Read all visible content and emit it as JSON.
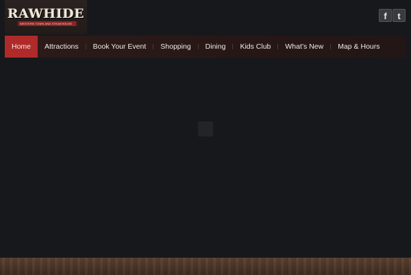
{
  "brand": {
    "name": "RAWHIDE",
    "tagline": "WESTERN TOWN AND STEAKHOUSE"
  },
  "social": {
    "facebook_label": "f",
    "twitter_label": "t"
  },
  "nav": {
    "items": [
      {
        "label": "Home",
        "active": true
      },
      {
        "label": "Attractions"
      },
      {
        "label": "Book Your Event"
      },
      {
        "label": "Shopping"
      },
      {
        "label": "Dining"
      },
      {
        "label": "Kids Club"
      },
      {
        "label": "What’s New"
      },
      {
        "label": "Map & Hours"
      }
    ]
  },
  "colors": {
    "background": "#17181c",
    "nav_bar": "#261716",
    "active_item": "#b02a2a",
    "wood_footer": "#4a3426"
  }
}
